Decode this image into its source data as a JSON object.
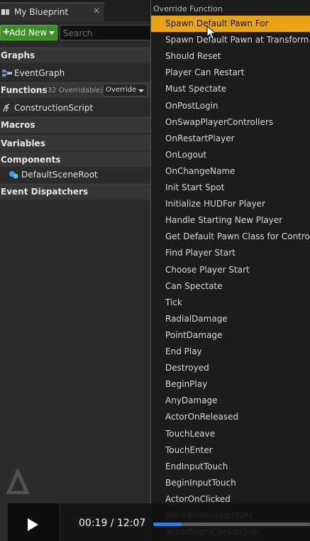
{
  "tab": {
    "title": "My Blueprint",
    "close": "✕"
  },
  "toolbar": {
    "add_plus": "+",
    "add_label": "Add New",
    "search_placeholder": "Search"
  },
  "sections": {
    "graphs": "Graphs",
    "functions": "Functions",
    "functions_count": "(32 Overridable)",
    "override_label": "Override",
    "macros": "Macros",
    "variables": "Variables",
    "components": "Components",
    "event_dispatchers": "Event Dispatchers"
  },
  "items": {
    "event_graph": "EventGraph",
    "construction_script": "ConstructionScript",
    "default_scene_root": "DefaultSceneRoot"
  },
  "menu": {
    "header": "Override Function",
    "selected_index": 0,
    "items": [
      "Spawn Default Pawn For",
      "Spawn Default Pawn at Transform",
      "Should Reset",
      "Player Can Restart",
      "Must Spectate",
      "OnPostLogin",
      "OnSwapPlayerControllers",
      "OnRestartPlayer",
      "OnLogout",
      "OnChangeName",
      "Init Start Spot",
      "Initialize HUDFor Player",
      "Handle Starting New Player",
      "Get Default Pawn Class for Controller",
      "Find Player Start",
      "Choose Player Start",
      "Can Spectate",
      "Tick",
      "RadialDamage",
      "PointDamage",
      "End Play",
      "Destroyed",
      "BeginPlay",
      "AnyDamage",
      "ActorOnReleased",
      "TouchLeave",
      "TouchEnter",
      "EndInputTouch",
      "BeginInputTouch",
      "ActorOnClicked",
      "ActorEndCursorOver",
      "ActorBeginCursorOver"
    ]
  },
  "player": {
    "time": "00:19 / 12:07",
    "progress": 0.182
  },
  "colors": {
    "accent_selected": "#e8a317",
    "add_button": "#3e8f29",
    "progress": "#2e7de0"
  },
  "icons": {
    "tab": "blueprint-icon",
    "graph": "event-graph-icon",
    "function": "function-icon",
    "component": "scene-component-icon",
    "play": "play-icon",
    "cursor": "mouse-cursor-icon"
  }
}
